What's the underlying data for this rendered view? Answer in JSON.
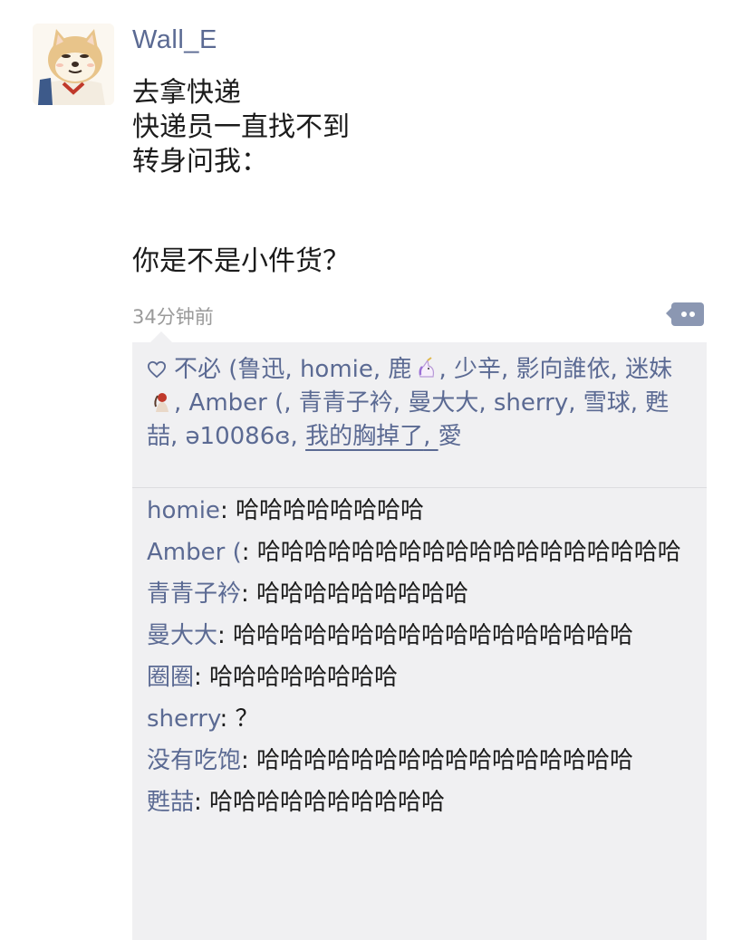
{
  "post": {
    "username": "Wall_E",
    "lines": [
      "去拿快递",
      "快递员一直找不到",
      "转身问我：",
      "你是不是小件货？"
    ],
    "time": "34分钟前"
  },
  "likes": {
    "icon": "heart-outline-icon",
    "names": [
      "不必 (鲁迅",
      "homie",
      "鹿",
      "少辛",
      "影向誰依",
      "迷妹",
      "Amber (",
      "青青子衿",
      "曼大大",
      "sherry",
      "雪球",
      "甦喆",
      "ə10086ɞ",
      "我的胸掉了",
      "愛"
    ],
    "separator": ", "
  },
  "comments": [
    {
      "author": "homie",
      "text": "哈哈哈哈哈哈哈哈"
    },
    {
      "author": "Amber (",
      "text": "哈哈哈哈哈哈哈哈哈哈哈哈哈哈哈哈哈哈"
    },
    {
      "author": "青青子衿",
      "text": "哈哈哈哈哈哈哈哈哈"
    },
    {
      "author": "曼大大",
      "text": "哈哈哈哈哈哈哈哈哈哈哈哈哈哈哈哈哈"
    },
    {
      "author": "圈圈",
      "text": "哈哈哈哈哈哈哈哈"
    },
    {
      "author": "sherry",
      "text": "？"
    },
    {
      "author": "没有吃饱",
      "text": "哈哈哈哈哈哈哈哈哈哈哈哈哈哈哈哈"
    },
    {
      "author": "甦喆",
      "text": "哈哈哈哈哈哈哈哈哈哈"
    }
  ],
  "colors": {
    "name": "#5b6a93",
    "panel": "#f0f0f2",
    "time": "#9a9a9a"
  }
}
